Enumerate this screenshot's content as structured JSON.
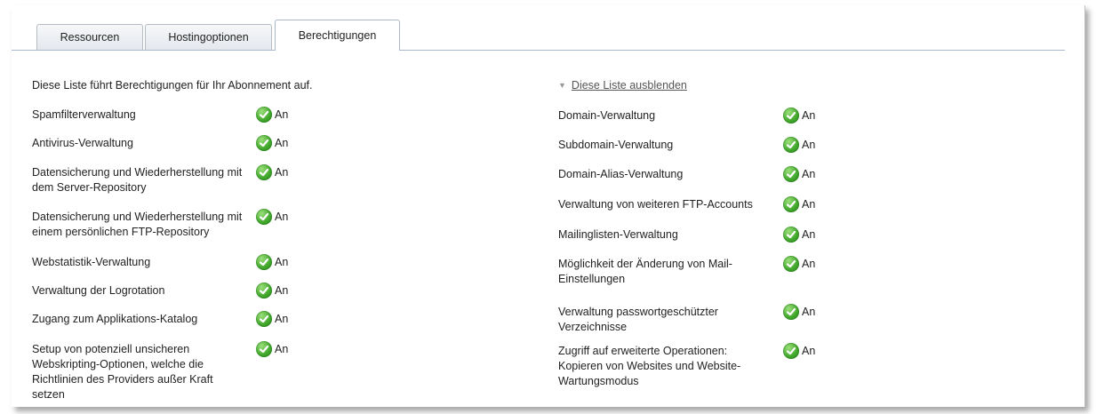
{
  "tabs": [
    {
      "label": "Ressourcen",
      "active": false
    },
    {
      "label": "Hostingoptionen",
      "active": false
    },
    {
      "label": "Berechtigungen",
      "active": true
    }
  ],
  "intro_text": "Diese Liste führt Berechtigungen für Ihr Abonnement auf.",
  "hide_link": "Diese Liste ausblenden",
  "left_permissions": [
    {
      "label": "Spamfilterverwaltung",
      "value": "An"
    },
    {
      "label": "Antivirus-Verwaltung",
      "value": "An"
    },
    {
      "label": "Datensicherung und Wiederherstellung mit dem Server-Repository",
      "value": "An"
    },
    {
      "label": "Datensicherung und Wiederherstellung mit einem persönlichen FTP-Repository",
      "value": "An"
    },
    {
      "label": "Webstatistik-Verwaltung",
      "value": "An"
    },
    {
      "label": "Verwaltung der Logrotation",
      "value": "An"
    },
    {
      "label": "Zugang zum Applikations-Katalog",
      "value": "An"
    },
    {
      "label": "Setup von potenziell unsicheren Webskripting-Optionen, welche die Richtlinien des Providers außer Kraft setzen",
      "value": "An"
    }
  ],
  "right_permissions": [
    {
      "label": "Domain-Verwaltung",
      "value": "An"
    },
    {
      "label": "Subdomain-Verwaltung",
      "value": "An"
    },
    {
      "label": "Domain-Alias-Verwaltung",
      "value": "An"
    },
    {
      "label": "Verwaltung von weiteren FTP-Accounts",
      "value": "An"
    },
    {
      "label": "Mailinglisten-Verwaltung",
      "value": "An"
    },
    {
      "label": "Möglichkeit der Änderung von Mail-Einstellungen",
      "value": "An"
    },
    {
      "label": "Verwaltung passwortgeschützter Verzeichnisse",
      "value": "An"
    },
    {
      "label": "Zugriff auf erweiterte Operationen: Kopieren von Websites und Website-Wartungsmodus",
      "value": "An"
    }
  ]
}
